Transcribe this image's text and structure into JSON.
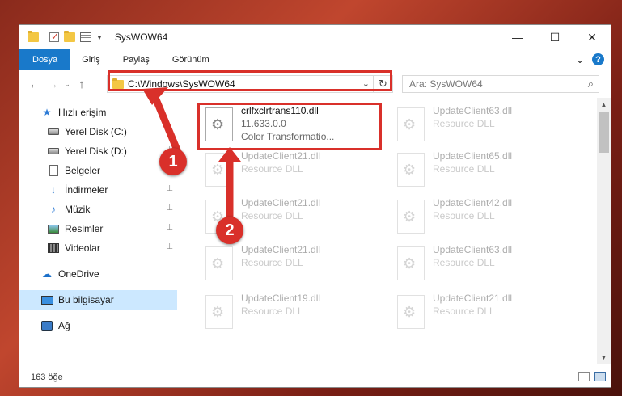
{
  "window": {
    "title": "SysWOW64"
  },
  "controls": {
    "minimize": "—",
    "maximize": "☐",
    "close": "✕"
  },
  "ribbon": {
    "tabs": [
      "Dosya",
      "Giriş",
      "Paylaş",
      "Görünüm"
    ],
    "collapse": "⌄",
    "help": "?"
  },
  "nav": {
    "back": "←",
    "forward": "→",
    "recent": "⌄",
    "up": "↑"
  },
  "address": {
    "path": "C:\\Windows\\SysWOW64",
    "dropdown": "⌄",
    "refresh": "↻"
  },
  "search": {
    "placeholder": "Ara: SysWOW64",
    "icon": "search-icon"
  },
  "sidebar": {
    "items": [
      {
        "label": "Hızlı erişim",
        "icon": "star-icon"
      },
      {
        "label": "Yerel Disk (C:)",
        "icon": "drive-icon",
        "pinned": true
      },
      {
        "label": "Yerel Disk (D:)",
        "icon": "drive-icon",
        "pinned": true
      },
      {
        "label": "Belgeler",
        "icon": "document-icon",
        "pinned": true
      },
      {
        "label": "İndirmeler",
        "icon": "download-icon",
        "pinned": true
      },
      {
        "label": "Müzik",
        "icon": "music-icon",
        "pinned": true
      },
      {
        "label": "Resimler",
        "icon": "picture-icon",
        "pinned": true
      },
      {
        "label": "Videolar",
        "icon": "video-icon",
        "pinned": true
      },
      {
        "label": "OneDrive",
        "icon": "cloud-icon"
      },
      {
        "label": "Bu bilgisayar",
        "icon": "computer-icon",
        "selected": true
      },
      {
        "label": "Ağ",
        "icon": "network-icon"
      }
    ],
    "pin_glyph": "📌"
  },
  "files": [
    {
      "name": "crlfxclrtrans110.dll",
      "version": "11.633.0.0",
      "desc": "Color Transformatio..."
    },
    {
      "name": "UpdateClient63.dll",
      "desc": "Resource DLL"
    },
    {
      "name": "UpdateClient21.dll",
      "desc": "Resource DLL"
    },
    {
      "name": "UpdateClient65.dll",
      "desc": "Resource DLL"
    },
    {
      "name": "UpdateClient21.dll",
      "desc": "Resource DLL"
    },
    {
      "name": "UpdateClient42.dll",
      "desc": "Resource DLL"
    },
    {
      "name": "UpdateClient21.dll",
      "desc": "Resource DLL"
    },
    {
      "name": "UpdateClient63.dll",
      "desc": "Resource DLL"
    },
    {
      "name": "UpdateClient19.dll",
      "desc": "Resource DLL"
    },
    {
      "name": "UpdateClient21.dll",
      "desc": "Resource DLL"
    }
  ],
  "status": {
    "count": "163 öğe"
  },
  "scroll": {
    "up": "▲",
    "down": "▼"
  },
  "annotations": {
    "badge1": "1",
    "badge2": "2",
    "color": "#d9302a"
  }
}
